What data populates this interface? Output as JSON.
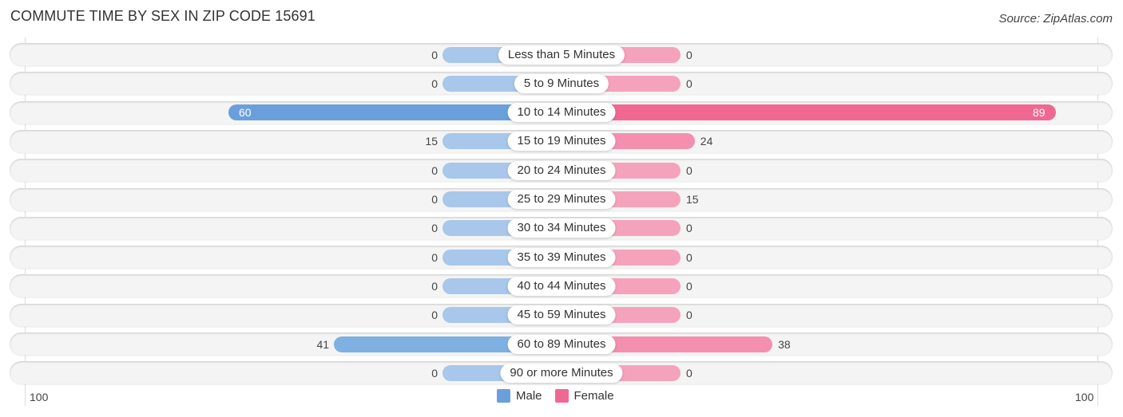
{
  "header": {
    "title": "COMMUTE TIME BY SEX IN ZIP CODE 15691",
    "source": "Source: ZipAtlas.com"
  },
  "colors": {
    "male": "#6a9fdb",
    "female": "#f06892",
    "male_light": "#a8c7ea",
    "female_light": "#f5a3bc"
  },
  "chart_data": {
    "type": "bar",
    "orientation": "horizontal-diverging",
    "title": "COMMUTE TIME BY SEX IN ZIP CODE 15691",
    "categories": [
      "Less than 5 Minutes",
      "5 to 9 Minutes",
      "10 to 14 Minutes",
      "15 to 19 Minutes",
      "20 to 24 Minutes",
      "25 to 29 Minutes",
      "30 to 34 Minutes",
      "35 to 39 Minutes",
      "40 to 44 Minutes",
      "45 to 59 Minutes",
      "60 to 89 Minutes",
      "90 or more Minutes"
    ],
    "series": [
      {
        "name": "Male",
        "values": [
          0,
          0,
          60,
          15,
          0,
          0,
          0,
          0,
          0,
          0,
          41,
          0
        ]
      },
      {
        "name": "Female",
        "values": [
          0,
          0,
          89,
          24,
          0,
          15,
          0,
          0,
          0,
          0,
          38,
          0
        ]
      }
    ],
    "axis": {
      "left_label": "100",
      "right_label": "100",
      "range": [
        -100,
        100
      ]
    },
    "legend": {
      "position": "bottom-center",
      "entries": [
        "Male",
        "Female"
      ]
    },
    "grid": false
  }
}
